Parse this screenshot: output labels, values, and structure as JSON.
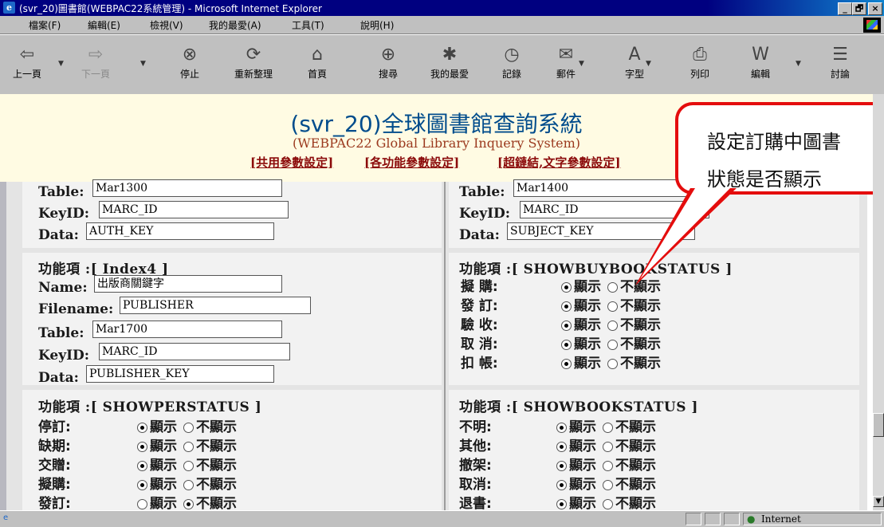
{
  "window": {
    "title": "(svr_20)圖書館(WEBPAC22系統管理) - Microsoft Internet Explorer",
    "controls": [
      "_",
      "🗗",
      "×"
    ]
  },
  "menu": [
    "檔案(F)",
    "編輯(E)",
    "檢視(V)",
    "我的最愛(A)",
    "工具(T)",
    "說明(H)"
  ],
  "toolbar": {
    "back": "上一頁",
    "forward": "下一頁",
    "stop": "停止",
    "refresh": "重新整理",
    "home": "首頁",
    "search": "搜尋",
    "favorites": "我的最愛",
    "history": "記錄",
    "mail": "郵件",
    "font": "字型",
    "print": "列印",
    "edit": "編輯",
    "discuss": "討論"
  },
  "header": {
    "title": "(svr_20)全球圖書館查詢系統",
    "subtitle": "(WEBPAC22 Global Library Inquery System)",
    "links": [
      "[共用參數設定]",
      "[各功能參數設定]",
      "[超鏈結,文字參數設定]"
    ]
  },
  "labels": {
    "table": "Table:",
    "keyid": "KeyID:",
    "data": "Data:",
    "name": "Name:",
    "filename": "Filename:"
  },
  "top_left": {
    "table": "Mar1300",
    "keyid": "MARC_ID",
    "data": "AUTH_KEY"
  },
  "top_right": {
    "table": "Mar1400",
    "keyid": "MARC_ID",
    "data": "SUBJECT_KEY"
  },
  "index4": {
    "title": "功能項 :[ Index4 ]",
    "name": "出版商關鍵字",
    "filename": "PUBLISHER",
    "table": "Mar1700",
    "keyid": "MARC_ID",
    "data": "PUBLISHER_KEY"
  },
  "options": {
    "show": "顯示",
    "hide": "不顯示"
  },
  "showbuybookstatus": {
    "title": "功能項 :[ SHOWBUYBOOKSTATUS ]",
    "rows": [
      {
        "label": "擬 購:",
        "selected": "show"
      },
      {
        "label": "發 訂:",
        "selected": "show"
      },
      {
        "label": "驗 收:",
        "selected": "show"
      },
      {
        "label": "取 消:",
        "selected": "show"
      },
      {
        "label": "扣 帳:",
        "selected": "show"
      }
    ]
  },
  "showperstatus": {
    "title": "功能項 :[ SHOWPERSTATUS ]",
    "rows": [
      {
        "label": "停訂:",
        "selected": "show"
      },
      {
        "label": "缺期:",
        "selected": "show"
      },
      {
        "label": "交贈:",
        "selected": "show"
      },
      {
        "label": "擬購:",
        "selected": "show"
      },
      {
        "label": "發訂:",
        "selected": "hide"
      }
    ]
  },
  "showbookstatus": {
    "title": "功能項 :[ SHOWBOOKSTATUS ]",
    "rows": [
      {
        "label": "不明:",
        "selected": "show"
      },
      {
        "label": "其他:",
        "selected": "show"
      },
      {
        "label": "撤架:",
        "selected": "show"
      },
      {
        "label": "取消:",
        "selected": "show"
      },
      {
        "label": "退書:",
        "selected": "show"
      }
    ]
  },
  "callout": {
    "line1": "設定訂購中圖書",
    "line2": "狀態是否顯示"
  },
  "status": {
    "zone": "Internet"
  },
  "colors": {
    "callout_border": "#e40d0d",
    "header_bg": "#fffbe3",
    "title_blue": "#004c8c"
  }
}
